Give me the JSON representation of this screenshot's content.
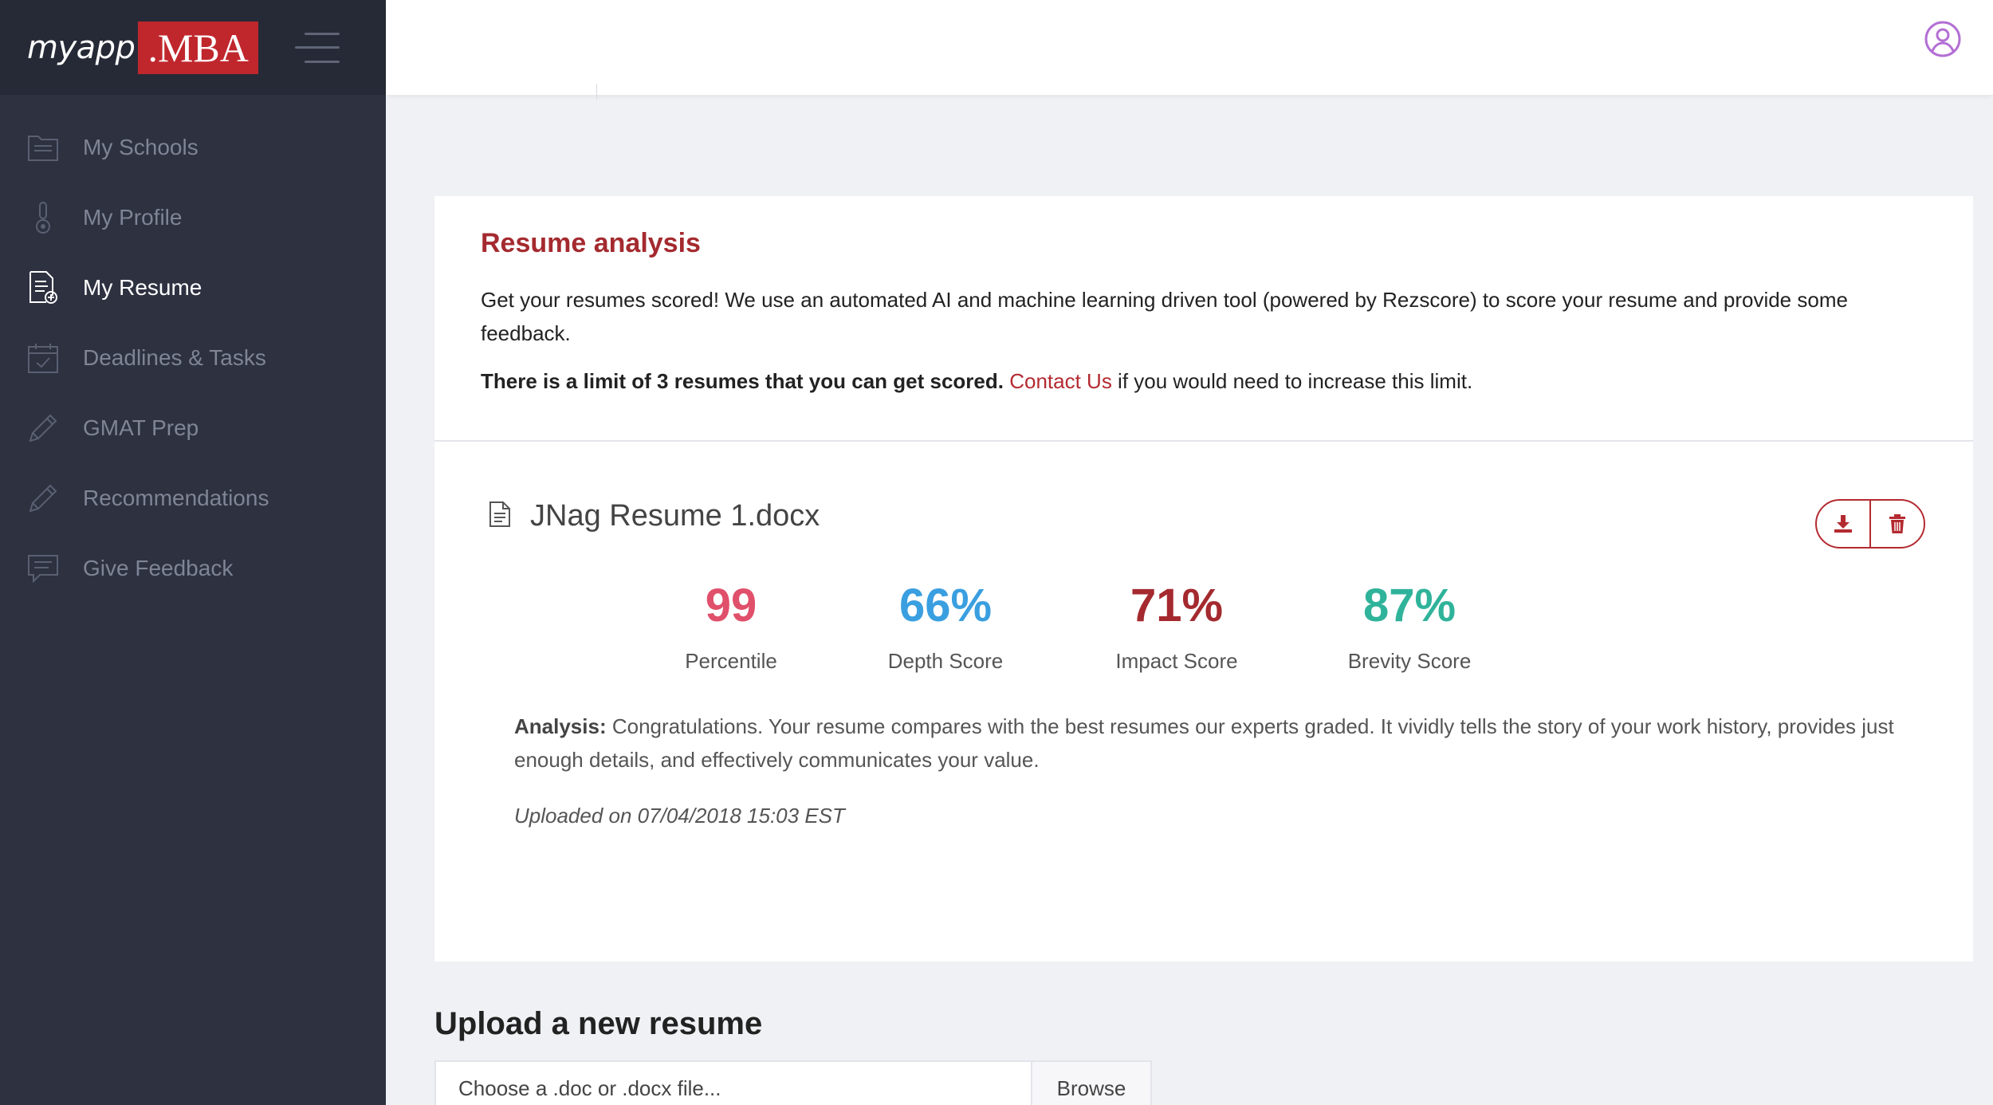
{
  "logo": {
    "text": "myapp",
    "badge": ".MBA"
  },
  "sidebar": {
    "items": [
      {
        "label": "My Schools",
        "icon": "folder-icon"
      },
      {
        "label": "My Profile",
        "icon": "profile-icon"
      },
      {
        "label": "My Resume",
        "icon": "resume-icon",
        "active": true
      },
      {
        "label": "Deadlines & Tasks",
        "icon": "calendar-icon"
      },
      {
        "label": "GMAT Prep",
        "icon": "pencil-icon"
      },
      {
        "label": "Recommendations",
        "icon": "pencil-icon"
      },
      {
        "label": "Give Feedback",
        "icon": "feedback-icon"
      }
    ]
  },
  "card": {
    "title": "Resume analysis",
    "description": "Get your resumes scored! We use an automated AI and machine learning driven tool (powered by Rezscore) to score your resume and provide some feedback.",
    "limit_bold": "There is a limit of 3 resumes that you can get scored.",
    "contact_link": "Contact Us",
    "limit_rest": " if you would need to increase this limit.",
    "file_name": "JNag Resume 1.docx",
    "scores": [
      {
        "value": "99",
        "label": "Percentile",
        "color": "#e0506a"
      },
      {
        "value": "66%",
        "label": "Depth Score",
        "color": "#3a9fe0"
      },
      {
        "value": "71%",
        "label": "Impact Score",
        "color": "#a42a2f"
      },
      {
        "value": "87%",
        "label": "Brevity Score",
        "color": "#2fb39a"
      }
    ],
    "analysis_label": "Analysis:",
    "analysis_text": " Congratulations. Your resume compares with the best resumes our experts graded. It vividly tells the story of your work history, provides just enough details, and effectively communicates your value.",
    "uploaded": "Uploaded on 07/04/2018 15:03 EST"
  },
  "upload": {
    "title": "Upload a new resume",
    "placeholder": "Choose a .doc or .docx file...",
    "browse_label": "Browse"
  },
  "colors": {
    "accent": "#b42a31",
    "sidebar_bg": "#2d3140",
    "user_icon": "#b36fd4"
  }
}
